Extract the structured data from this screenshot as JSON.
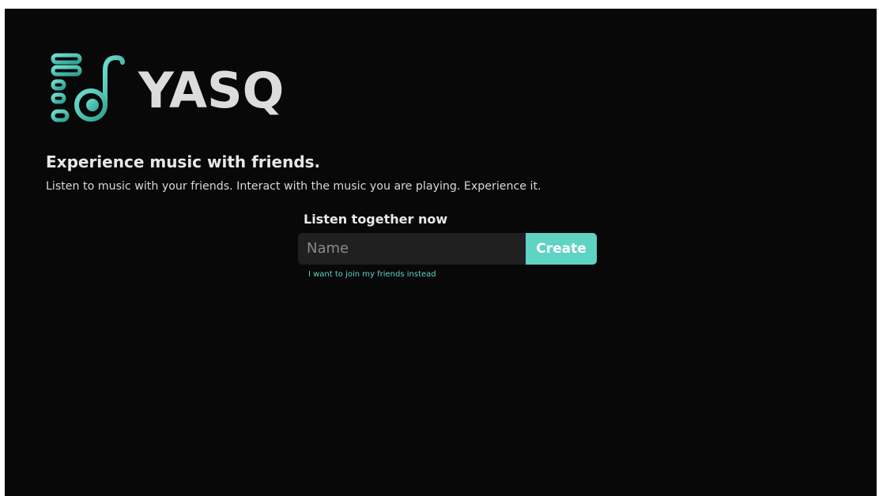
{
  "brand": {
    "name": "YASQ",
    "logo_icon": "music-note-logo-icon",
    "accent_color": "#5fd3c4"
  },
  "hero": {
    "title": "Experience music with friends.",
    "subtitle": "Listen to music with your friends. Interact with the music you are playing. Experience it."
  },
  "form": {
    "heading": "Listen together now",
    "name_value": "",
    "name_placeholder": "Name",
    "create_label": "Create",
    "join_link_label": "I want to join my friends instead"
  }
}
